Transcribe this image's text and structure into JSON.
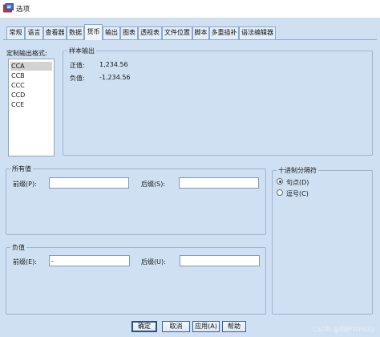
{
  "window": {
    "title": "选项",
    "accent_color": "#cfe0f3"
  },
  "tabs": [
    {
      "label": "常规"
    },
    {
      "label": "语言"
    },
    {
      "label": "查看器"
    },
    {
      "label": "数据"
    },
    {
      "label": "货币",
      "active": true
    },
    {
      "label": "输出"
    },
    {
      "label": "图表"
    },
    {
      "label": "透视表"
    },
    {
      "label": "文件位置"
    },
    {
      "label": "脚本"
    },
    {
      "label": "多重插补"
    },
    {
      "label": "语法编辑器"
    }
  ],
  "custom_format": {
    "label": "定制输出格式:",
    "items": [
      "CCA",
      "CCB",
      "CCC",
      "CCD",
      "CCE"
    ],
    "selected": "CCA"
  },
  "sample_output": {
    "label": "样本输出",
    "positive_label": "正值:",
    "positive_value": "1,234.56",
    "negative_label": "负值:",
    "negative_value": "-1,234.56"
  },
  "all_values": {
    "label": "所有值",
    "prefix_label": "前缀(P):",
    "prefix_value": "",
    "suffix_label": "后缀(S):",
    "suffix_value": ""
  },
  "negative_values": {
    "label": "负值",
    "prefix_label": "前缀(E):",
    "prefix_value": "-",
    "suffix_label": "后缀(U):",
    "suffix_value": ""
  },
  "decimal_separator": {
    "label": "十进制分隔符",
    "options": [
      {
        "label": "句点(D)",
        "checked": true
      },
      {
        "label": "逗号(C)",
        "checked": false
      }
    ]
  },
  "buttons": {
    "ok": "确定",
    "cancel": "取消",
    "apply": "应用(A)",
    "help": "帮助"
  },
  "watermark": "CSDN @倒杯Whisky"
}
